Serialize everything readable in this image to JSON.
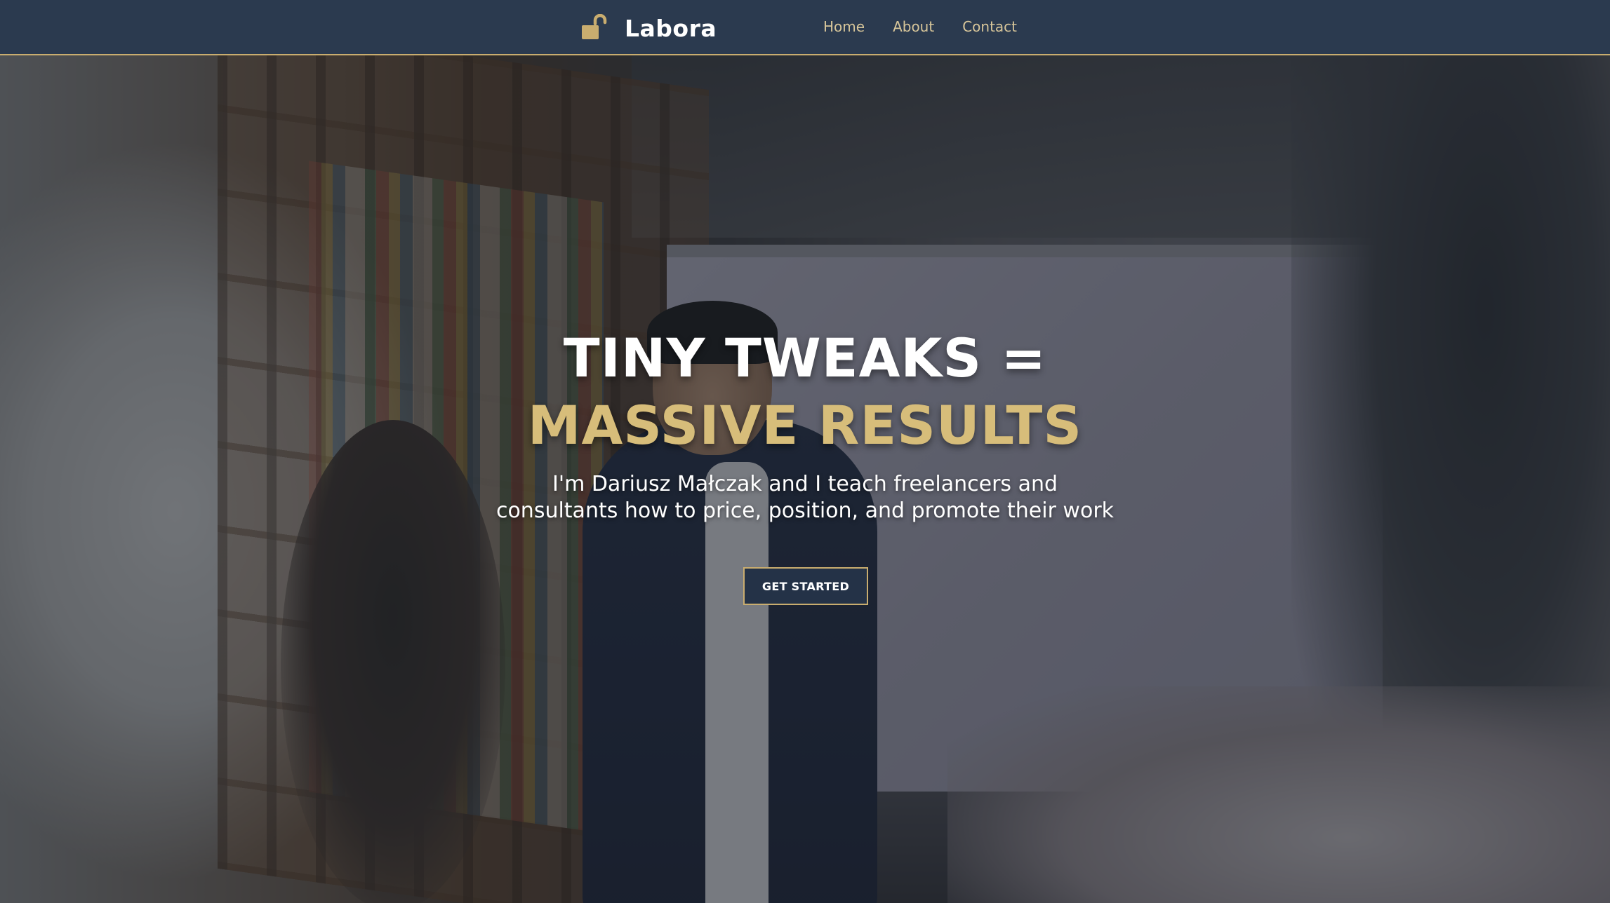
{
  "brand": {
    "name": "Labora",
    "icon": "unlocked-padlock-icon"
  },
  "nav": {
    "links": [
      "Home",
      "About",
      "Contact"
    ]
  },
  "hero": {
    "headline_line1": "TINY TWEAKS =",
    "headline_line2": "MASSIVE RESULTS",
    "subtitle_line1": "I'm Dariusz Małczak and I teach freelancers and",
    "subtitle_line2": "consultants how to price, position, and promote their work",
    "cta_label": "GET STARTED"
  },
  "colors": {
    "nav_bg": "#2b3a4f",
    "accent_gold": "#c9ad6f",
    "headline_gold": "#d7bd7a",
    "nav_link": "#d8c69a",
    "button_bg": "#243247"
  }
}
